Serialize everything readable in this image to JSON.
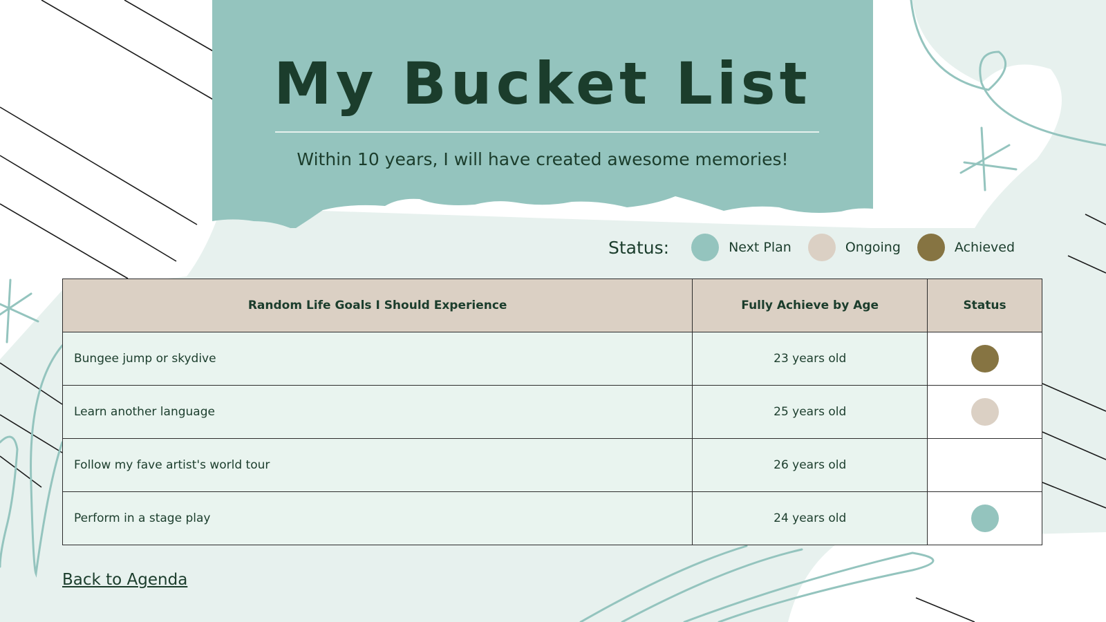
{
  "title": "My Bucket List",
  "subtitle": "Within 10 years, I will have created awesome memories!",
  "legend": {
    "title": "Status:",
    "items": [
      {
        "label": "Next Plan",
        "color": "#94c4be"
      },
      {
        "label": "Ongoing",
        "color": "#dbd0c4"
      },
      {
        "label": "Achieved",
        "color": "#867442"
      }
    ]
  },
  "table": {
    "headers": [
      "Random Life Goals I Should Experience",
      "Fully Achieve by Age",
      "Status"
    ],
    "rows": [
      {
        "goal": "Bungee jump or skydive",
        "age": "23 years old",
        "status": "Achieved",
        "status_color": "#867442"
      },
      {
        "goal": "Learn another language",
        "age": "25 years old",
        "status": "Ongoing",
        "status_color": "#dbd0c4"
      },
      {
        "goal": "Follow my fave artist's world tour",
        "age": "26 years old",
        "status": "",
        "status_color": ""
      },
      {
        "goal": "Perform in a stage play",
        "age": "24 years old",
        "status": "Next Plan",
        "status_color": "#94c4be"
      }
    ]
  },
  "back_link": "Back to Agenda",
  "colors": {
    "banner": "#94c4be",
    "wash": "#e7f1ee",
    "text": "#1b3d2c",
    "header_bg": "#dbd0c4",
    "cell_bg": "#e9f4ef"
  }
}
